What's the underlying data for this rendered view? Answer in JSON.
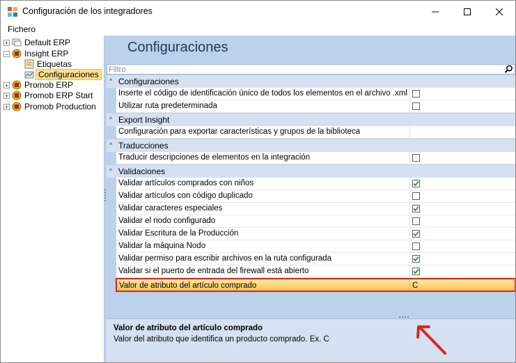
{
  "window": {
    "title": "Configuración de los integradores"
  },
  "menu": {
    "file": "Fichero"
  },
  "tree": {
    "items": [
      {
        "label": "Default ERP",
        "expander": "+",
        "icon": "integrator-icon"
      },
      {
        "label": "Insight ERP",
        "expander": "−",
        "icon": "insight-erp-icon"
      },
      {
        "label": "Etiquetas",
        "icon": "labels-icon"
      },
      {
        "label": "Configuraciones",
        "icon": "settings-icon",
        "selected": true
      },
      {
        "label": "Promob ERP",
        "expander": "+",
        "icon": "promob-icon"
      },
      {
        "label": "Promob ERP Start",
        "expander": "+",
        "icon": "promob-icon"
      },
      {
        "label": "Promob Production",
        "expander": "+",
        "icon": "promob-icon"
      }
    ]
  },
  "panel": {
    "title": "Configuraciones",
    "filter_placeholder": "Filtro",
    "categories": [
      {
        "label": "Configuraciones",
        "chevron": "^",
        "props": [
          {
            "label": "Inserte el código de identificación único de todos los elementos en el archivo .xml",
            "checked": false
          },
          {
            "label": "Utilizar ruta predeterminada",
            "checked": false
          }
        ]
      },
      {
        "label": "Export Insight",
        "chevron": "^",
        "props": [
          {
            "label": "Configuración para exportar características y grupos de la biblioteca"
          }
        ]
      },
      {
        "label": "Traducciones",
        "chevron": "^",
        "props": [
          {
            "label": "Traducir descripciones de elementos en la integración",
            "checked": false
          }
        ]
      },
      {
        "label": "Validaciones",
        "chevron": "^",
        "props": [
          {
            "label": "Validar artículos comprados con niños",
            "checked": true
          },
          {
            "label": "Validar artículos con código duplicado",
            "checked": false
          },
          {
            "label": "Validar caracteres especiales",
            "checked": true
          },
          {
            "label": "Validar el nodo configurado",
            "checked": false
          },
          {
            "label": "Validar Escritura de la Producción",
            "checked": true
          },
          {
            "label": "Validar la máquina Nodo",
            "checked": false
          },
          {
            "label": "Validar permiso para escribir archivos en la ruta configurada",
            "checked": true
          },
          {
            "label": "Validar si el puerto de entrada del firewall está abierto",
            "checked": true
          },
          {
            "label": "Valor de atributo del artículo comprado",
            "value": "C",
            "selected": true
          }
        ]
      }
    ],
    "description": {
      "title": "Valor de atributo del artículo comprado",
      "text": "Valor del atributo que identifica un producto comprado. Ex. C"
    }
  },
  "colors": {
    "selection": "#f9c453",
    "highlight_border": "#d9261c",
    "check": "#2e7d32",
    "arrow": "#e0261c"
  }
}
